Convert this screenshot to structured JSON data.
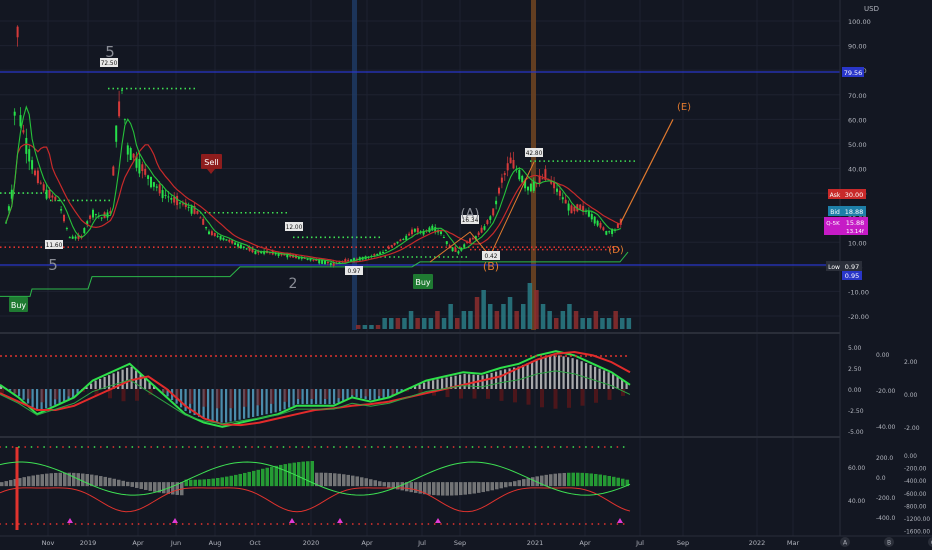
{
  "colors": {
    "bg": "#131722",
    "grid": "#1e2230",
    "axis_text": "#b2b5be",
    "green_candle": "#26e04a",
    "red_candle": "#d63a3a",
    "blue_line": "#2936c9",
    "wave_text": "#8a8d96",
    "orange": "#e0792e",
    "green_dots": "#3ee053",
    "red_dots": "#e0332e",
    "vol_teal": "#2a7c86",
    "vol_red": "#8e2e2e"
  },
  "axis": {
    "currency": "USD",
    "price_ticks": [
      "100.00",
      "90.00",
      "80.00",
      "70.00",
      "60.00",
      "50.00",
      "40.00",
      "30.00",
      "20.00",
      "10.00",
      "0.00",
      "-10.00",
      "-20.00"
    ],
    "x_ticks": [
      "Nov",
      "2019",
      "Apr",
      "Jun",
      "Aug",
      "Oct",
      "2020",
      "Apr",
      "Jul",
      "Sep",
      "2021",
      "Apr",
      "Jul",
      "Sep",
      "2022",
      "Mar"
    ],
    "osc1_ticks": [
      "5.00",
      "2.50",
      "0.00",
      "-2.50",
      "-5.00"
    ],
    "osc1_mid_ticks": [
      "0.00",
      "-20.00",
      "-40.00"
    ],
    "osc1_right_ticks": [
      "2.00",
      "0.00",
      "-2.00"
    ],
    "osc2_ticks": [
      "60.00",
      "40.00"
    ],
    "osc2_mid_ticks": [
      "200.0",
      "0.0",
      "-200.0",
      "-400.0"
    ],
    "osc2_right_ticks": [
      "0.00",
      "-200.00",
      "-400.00",
      "-600.00",
      "-800.00",
      "-1200.00",
      "-1600.00"
    ],
    "corner_icons": [
      "A",
      "B",
      "C"
    ]
  },
  "badges": {
    "level": "79.56",
    "ask_label": "Ask",
    "ask": "30.00",
    "bid_label": "Bid",
    "bid": "18.88",
    "symbol_label": "Q-5K",
    "symbol_value": "15.88",
    "symbol_sub": "13.14f",
    "low_label": "Low",
    "low": "0.97",
    "low2": "0.95"
  },
  "signals": {
    "buy": "Buy",
    "sell": "Sell"
  },
  "price_tags": [
    "72.50",
    "11.60",
    "12.00",
    "0.97",
    "16.34",
    "0.42",
    "42.80"
  ],
  "waves": [
    "5",
    "5",
    "2",
    "(A)",
    "(B)",
    "(D)",
    "(E)"
  ],
  "chart_data": {
    "type": "candlestick",
    "currency": "USD",
    "ylim": [
      -20,
      100
    ],
    "levels": [
      79.56,
      0.95
    ],
    "x_labels": [
      "Nov",
      "2019",
      "Apr",
      "Jun",
      "Aug",
      "Oct",
      "2020",
      "Apr",
      "Jul",
      "Sep",
      "2021",
      "Apr",
      "Jul",
      "Sep",
      "2022",
      "Mar"
    ],
    "price_path": [
      [
        0,
        18
      ],
      [
        2,
        30
      ],
      [
        4,
        95
      ],
      [
        5,
        60
      ],
      [
        7,
        50
      ],
      [
        10,
        38
      ],
      [
        14,
        30
      ],
      [
        18,
        27
      ],
      [
        22,
        12
      ],
      [
        26,
        12
      ],
      [
        28,
        18
      ],
      [
        30,
        22
      ],
      [
        33,
        20
      ],
      [
        36,
        22
      ],
      [
        38,
        55
      ],
      [
        40,
        72
      ],
      [
        42,
        48
      ],
      [
        44,
        45
      ],
      [
        47,
        40
      ],
      [
        50,
        35
      ],
      [
        54,
        30
      ],
      [
        58,
        27
      ],
      [
        62,
        25
      ],
      [
        66,
        22
      ],
      [
        70,
        14
      ],
      [
        74,
        12
      ],
      [
        78,
        10
      ],
      [
        82,
        8
      ],
      [
        86,
        6
      ],
      [
        90,
        6
      ],
      [
        95,
        5
      ],
      [
        100,
        4
      ],
      [
        105,
        3
      ],
      [
        110,
        2
      ],
      [
        113,
        1
      ],
      [
        116,
        2
      ],
      [
        120,
        3
      ],
      [
        125,
        4
      ],
      [
        130,
        6
      ],
      [
        135,
        10
      ],
      [
        138,
        12
      ],
      [
        141,
        15
      ],
      [
        144,
        14
      ],
      [
        147,
        16
      ],
      [
        150,
        14
      ],
      [
        153,
        8
      ],
      [
        156,
        6
      ],
      [
        159,
        10
      ],
      [
        162,
        12
      ],
      [
        165,
        16
      ],
      [
        168,
        22
      ],
      [
        171,
        35
      ],
      [
        174,
        43
      ],
      [
        177,
        38
      ],
      [
        180,
        32
      ],
      [
        183,
        34
      ],
      [
        186,
        37
      ],
      [
        189,
        33
      ],
      [
        192,
        28
      ],
      [
        195,
        23
      ],
      [
        198,
        24
      ],
      [
        201,
        22
      ],
      [
        204,
        18
      ],
      [
        207,
        14
      ],
      [
        210,
        15
      ],
      [
        212,
        18
      ]
    ],
    "projection": [
      [
        212,
        18
      ],
      [
        230,
        60
      ]
    ],
    "volume": [
      0,
      0,
      0,
      0,
      1,
      1,
      1,
      1,
      2,
      1,
      1,
      1,
      2,
      1,
      3,
      1,
      2,
      2,
      4,
      5,
      3,
      2,
      3,
      4,
      2,
      3,
      6,
      5,
      3,
      2,
      1,
      2,
      3,
      2,
      1,
      1,
      2,
      1,
      1,
      2,
      1,
      1
    ],
    "osc1": {
      "ylim": [
        -5,
        5
      ],
      "fast": [
        0.5,
        -1,
        -3,
        -2,
        -1,
        1,
        2,
        3,
        1,
        -1,
        -3,
        -4,
        -4.5,
        -4,
        -3.5,
        -3,
        -2,
        -2,
        -2,
        -1,
        -1.5,
        -1,
        0,
        1,
        1.5,
        2,
        1.8,
        2.5,
        3,
        4,
        4.5,
        4,
        3,
        2,
        0.5
      ],
      "slow": [
        -0.5,
        -1.5,
        -2.5,
        -2.5,
        -2,
        -1,
        0,
        1,
        1.5,
        0,
        -2,
        -3.5,
        -4.2,
        -4.3,
        -4,
        -3.5,
        -3,
        -2.5,
        -2.3,
        -2,
        -1.8,
        -1.5,
        -1,
        -0.5,
        0,
        0.5,
        1,
        1.5,
        2.5,
        3.5,
        4.2,
        4.4,
        4,
        3.2,
        2
      ]
    },
    "osc2": {
      "ylim": [
        20,
        80
      ]
    }
  }
}
